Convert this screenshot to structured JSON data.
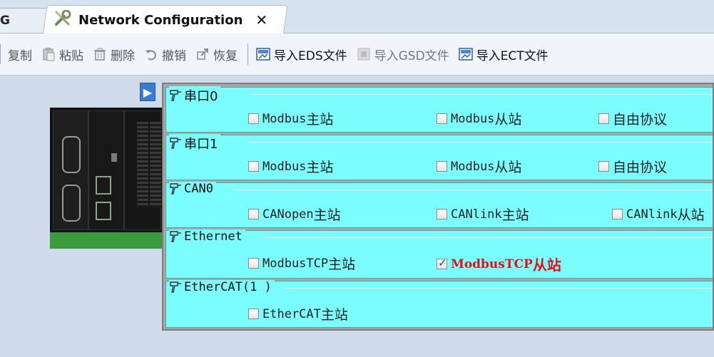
{
  "tabs": {
    "prev_label": "G",
    "active_label": "Network Configuration",
    "close_symbol": "✕"
  },
  "toolbar": {
    "items": [
      {
        "label": "复制",
        "icon": "copy-icon",
        "enabled": false
      },
      {
        "label": "粘贴",
        "icon": "paste-icon",
        "enabled": false
      },
      {
        "label": "删除",
        "icon": "delete-icon",
        "enabled": false
      },
      {
        "label": "撤销",
        "icon": "undo-icon",
        "enabled": false
      },
      {
        "label": "恢复",
        "icon": "redo-icon",
        "enabled": false
      },
      {
        "label": "导入EDS文件",
        "icon": "import-eds-icon",
        "enabled": true
      },
      {
        "label": "导入GSD文件",
        "icon": "import-gsd-icon",
        "enabled": false
      },
      {
        "label": "导入ECT文件",
        "icon": "import-ect-icon",
        "enabled": true
      }
    ]
  },
  "groups": [
    {
      "title": "串口0",
      "options": [
        {
          "prefix": "Modbus ",
          "suffix": "主站",
          "checked": false
        },
        {
          "prefix": "Modbus ",
          "suffix": "从站",
          "checked": false
        },
        {
          "prefix": "",
          "suffix": "自由协议",
          "checked": false
        }
      ]
    },
    {
      "title": "串口1",
      "options": [
        {
          "prefix": "Modbus ",
          "suffix": "主站",
          "checked": false
        },
        {
          "prefix": "Modbus ",
          "suffix": "从站",
          "checked": false
        },
        {
          "prefix": "",
          "suffix": "自由协议",
          "checked": false
        }
      ]
    },
    {
      "title": "CAN0",
      "options": [
        {
          "prefix": "CANopen ",
          "suffix": "主站",
          "checked": false
        },
        {
          "prefix": "CANlink ",
          "suffix": "主站",
          "checked": false
        },
        {
          "prefix": "CANlink ",
          "suffix": "从站",
          "checked": false
        }
      ]
    },
    {
      "title": "Ethernet",
      "options": [
        {
          "prefix": "ModbusTCP ",
          "suffix": "主站",
          "checked": false
        },
        {
          "prefix": "ModbusTCP ",
          "suffix": "从站",
          "checked": true
        }
      ]
    },
    {
      "title": "EtherCAT(1 )",
      "options": [
        {
          "prefix": "EtherCAT ",
          "suffix": "主站",
          "checked": false
        }
      ]
    }
  ],
  "colors": {
    "panel_bg": "#7cfdfd",
    "checked_text": "#e1111b",
    "device_green": "#3c9a3e"
  }
}
